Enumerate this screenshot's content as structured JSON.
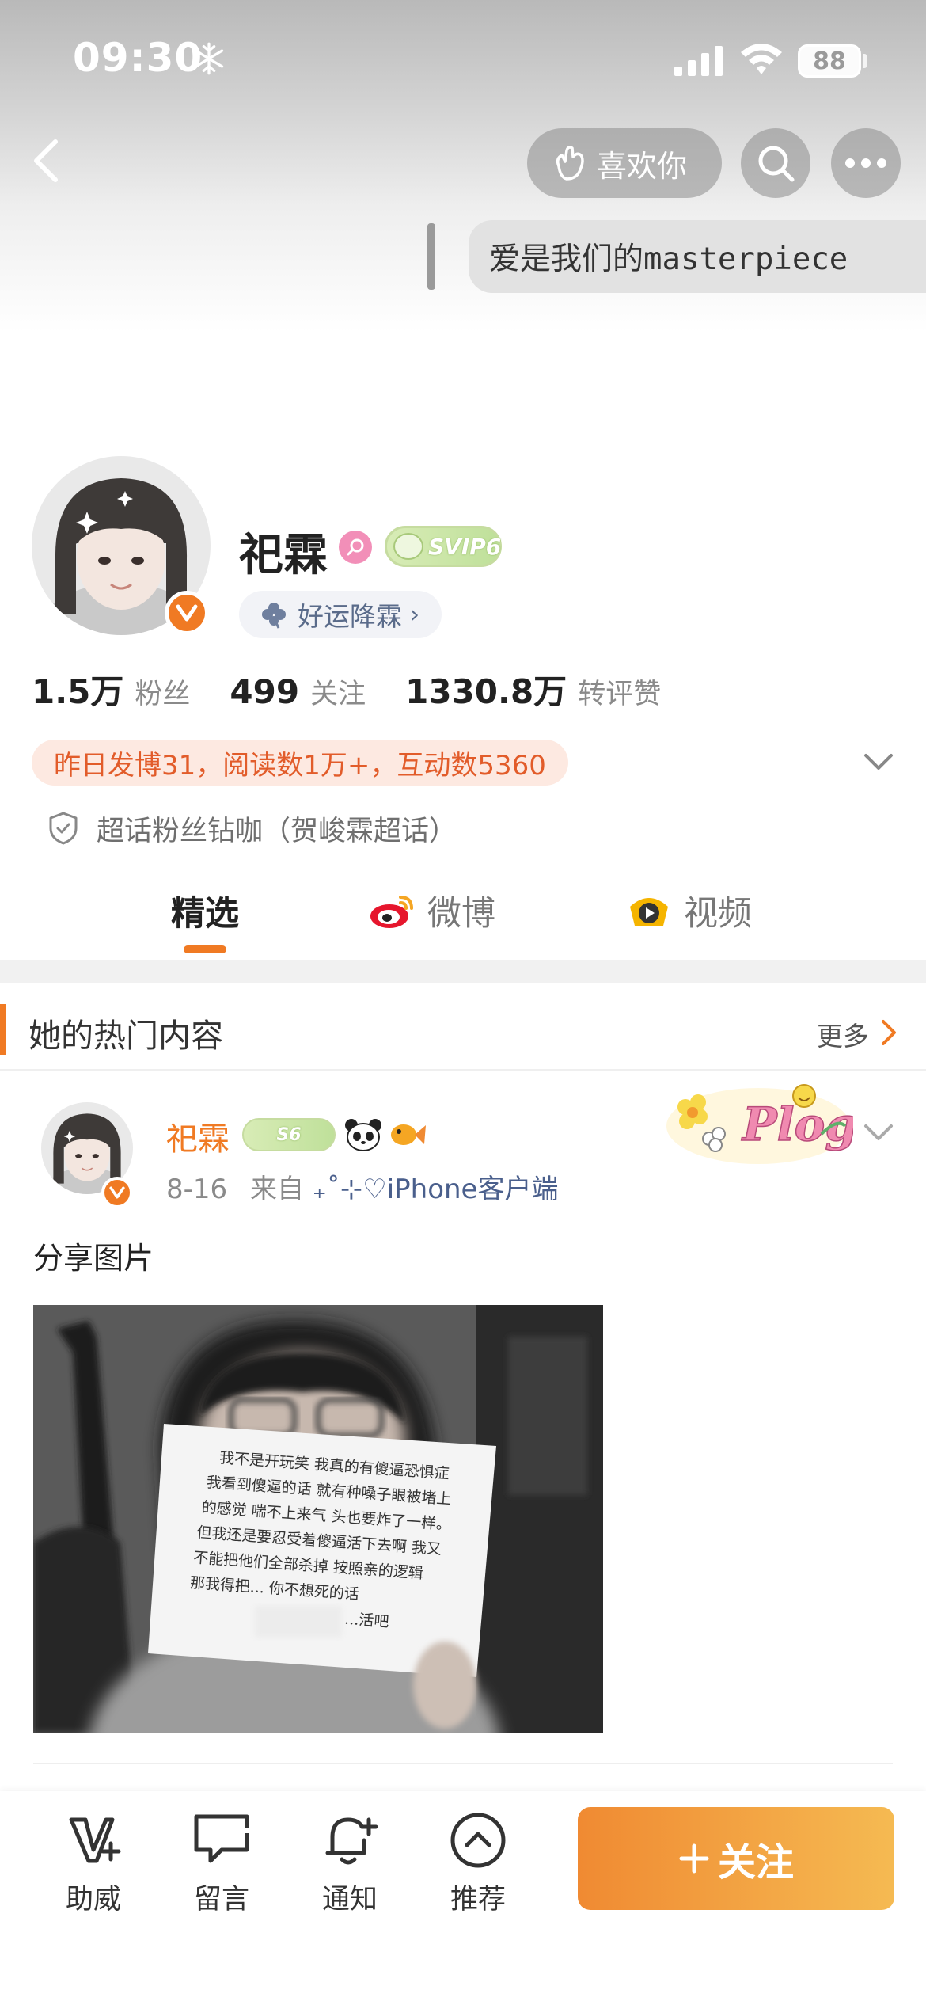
{
  "status_bar": {
    "time": "09:30",
    "battery": "88"
  },
  "nav": {
    "like_label": "喜欢你"
  },
  "signature": "爱是我们的masterpiece",
  "profile": {
    "name": "祀霖",
    "svip_label": "SVIP6",
    "luck_tag": "好运降霖",
    "stats": [
      {
        "value": "1.5万",
        "label": "粉丝"
      },
      {
        "value": "499",
        "label": "关注"
      },
      {
        "value": "1330.8万",
        "label": "转评赞"
      }
    ],
    "activity": "昨日发博31，阅读数1万+，互动数5360",
    "supertopic": "超话粉丝钻咖（贺峻霖超话）"
  },
  "tabs": [
    {
      "label": "精选",
      "active": true
    },
    {
      "label": "微博",
      "active": false
    },
    {
      "label": "视频",
      "active": false
    }
  ],
  "hot_section": {
    "title": "她的热门内容",
    "more": "更多"
  },
  "post": {
    "author": "祀霖",
    "svip_label": "S6",
    "date": "8-16",
    "source_prefix": "来自",
    "source": "₊˚⊹♡iPhone客户端",
    "text": "分享图片",
    "sticker_text": "Plog",
    "image_note_lines": [
      "我不是开玩笑 我真的有傻逼恐惧症",
      "我看到傻逼的话 就有种嗓子眼被堵上",
      "的感觉 喘不上来气 头也要炸了一样。",
      "但我还是要忍受着傻逼活下去啊 我又",
      "不能把他们全部杀掉 按照亲的逻辑",
      "那我得把... 你不想死的话",
      "...活吧"
    ]
  },
  "toolbar": {
    "items": [
      {
        "label": "助威",
        "icon": "cheer-v-icon"
      },
      {
        "label": "留言",
        "icon": "message-icon"
      },
      {
        "label": "通知",
        "icon": "bell-plus-icon"
      },
      {
        "label": "推荐",
        "icon": "chevron-up-circle-icon"
      }
    ],
    "follow_label": "关注"
  },
  "colors": {
    "accent": "#f07a23",
    "follow_start": "#f08a32",
    "follow_end": "#f5ba52",
    "activity_bg": "#fde9e1",
    "activity_text": "#e25c2a"
  }
}
